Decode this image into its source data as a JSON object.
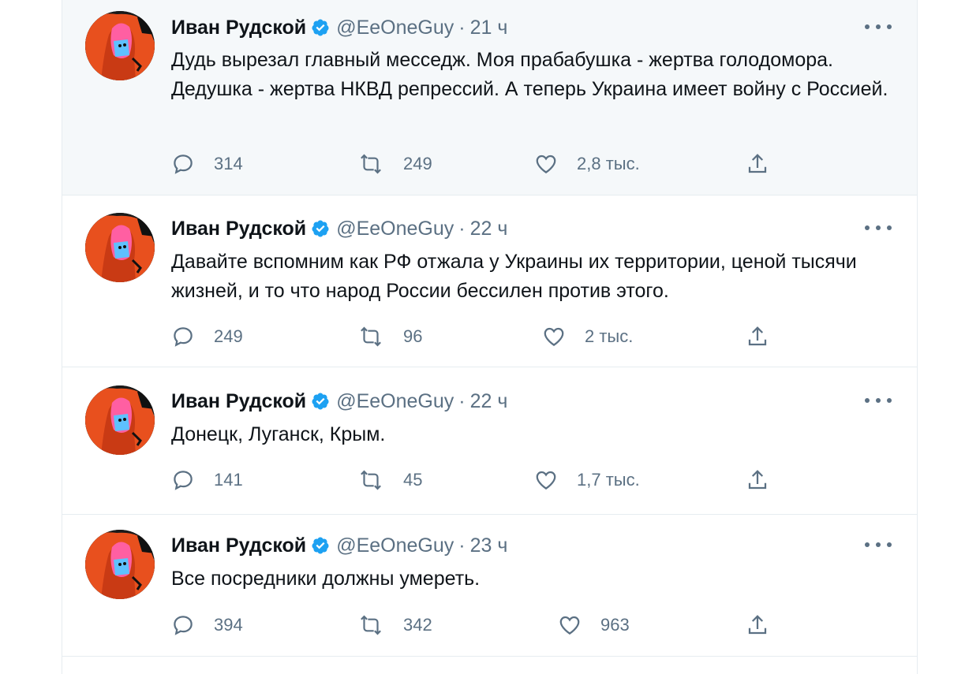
{
  "tweets": [
    {
      "name": "Иван Рудской",
      "handle": "@EeOneGuy",
      "dot": "·",
      "time": "21 ч",
      "text": "Дудь вырезал главный месседж. Моя прабабушка - жертва голодомора. Дедушка - жертва НКВД репрессий. А теперь Украина имеет войну с Россией.",
      "replies": "314",
      "retweets": "249",
      "likes": "2,8 тыс."
    },
    {
      "name": "Иван Рудской",
      "handle": "@EeOneGuy",
      "dot": "·",
      "time": "22 ч",
      "text": "Давайте вспомним как РФ отжала у Украины их территории, ценой тысячи жизней, и то что народ России бессилен против этого.",
      "replies": "249",
      "retweets": "96",
      "likes": "2 тыс."
    },
    {
      "name": "Иван Рудской",
      "handle": "@EeOneGuy",
      "dot": "·",
      "time": "22 ч",
      "text": "Донецк, Луганск, Крым.",
      "replies": "141",
      "retweets": "45",
      "likes": "1,7 тыс."
    },
    {
      "name": "Иван Рудской",
      "handle": "@EeOneGuy",
      "dot": "·",
      "time": "23 ч",
      "text": "Все посредники должны умереть.",
      "replies": "394",
      "retweets": "342",
      "likes": "963"
    }
  ],
  "colors": {
    "text": "#0f1419",
    "secondary": "#5b7083",
    "verified": "#1da1f2",
    "hover_bg": "#f5f8fa",
    "divider": "#e6ecf0"
  },
  "icons": {
    "verified": "verified-badge-icon",
    "more": "more-dots-icon",
    "reply": "reply-bubble-icon",
    "retweet": "retweet-icon",
    "like": "heart-icon",
    "share": "share-upload-icon"
  }
}
